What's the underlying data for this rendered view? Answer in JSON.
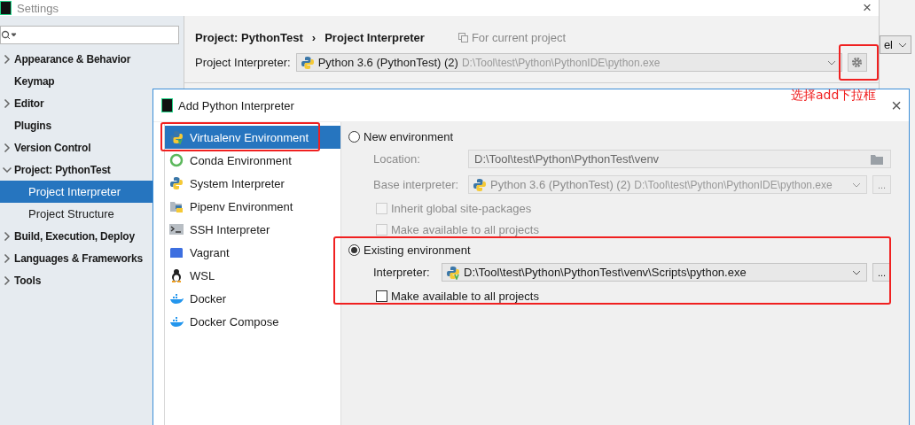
{
  "settings_window": {
    "title": "Settings",
    "close": "×"
  },
  "sidebar": {
    "items": [
      {
        "label": "Appearance & Behavior",
        "expanded": false,
        "selected": false
      },
      {
        "label": "Keymap",
        "selected": false
      },
      {
        "label": "Editor",
        "expanded": false,
        "selected": false
      },
      {
        "label": "Plugins",
        "selected": false
      },
      {
        "label": "Version Control",
        "expanded": false,
        "selected": false
      },
      {
        "label": "Project: PythonTest",
        "expanded": true,
        "selected": false,
        "children": [
          {
            "label": "Project Interpreter",
            "selected": true
          },
          {
            "label": "Project Structure",
            "selected": false
          }
        ]
      },
      {
        "label": "Build, Execution, Deploy",
        "expanded": false,
        "selected": false
      },
      {
        "label": "Languages & Frameworks",
        "expanded": false,
        "selected": false
      },
      {
        "label": "Tools",
        "expanded": false,
        "selected": false
      }
    ]
  },
  "breadcrumb": {
    "items": [
      "Project: PythonTest",
      "Project Interpreter"
    ],
    "separator": "›",
    "scope_note": "For current project"
  },
  "interpreter": {
    "label": "Project Interpreter:",
    "name": "Python 3.6 (PythonTest) (2)",
    "path": "D:\\Tool\\test\\Python\\PythonIDE\\python.exe"
  },
  "background_dropdown": {
    "value": "el"
  },
  "annotation": {
    "text": "选择add下拉框"
  },
  "dialog": {
    "title": "Add Python Interpreter",
    "close": "×",
    "types": [
      {
        "label": "Virtualenv Environment",
        "selected": true
      },
      {
        "label": "Conda Environment",
        "selected": false
      },
      {
        "label": "System Interpreter",
        "selected": false
      },
      {
        "label": "Pipenv Environment",
        "selected": false
      },
      {
        "label": "SSH Interpreter",
        "selected": false
      },
      {
        "label": "Vagrant",
        "selected": false
      },
      {
        "label": "WSL",
        "selected": false
      },
      {
        "label": "Docker",
        "selected": false
      },
      {
        "label": "Docker Compose",
        "selected": false
      }
    ],
    "new_environment": {
      "label": "New environment",
      "selected": false,
      "location": {
        "label": "Location:",
        "value": "D:\\Tool\\test\\Python\\PythonTest\\venv"
      },
      "base_interpreter": {
        "label": "Base interpreter:",
        "name": "Python 3.6 (PythonTest) (2)",
        "path": "D:\\Tool\\test\\Python\\PythonIDE\\python.exe",
        "browse": "..."
      },
      "checkboxes": [
        {
          "label": "Inherit global site-packages",
          "checked": false
        },
        {
          "label": "Make available to all projects",
          "checked": false
        }
      ]
    },
    "existing_environment": {
      "label": "Existing environment",
      "selected": true,
      "interpreter": {
        "label": "Interpreter:",
        "value": "D:\\Tool\\test\\Python\\PythonTest\\venv\\Scripts\\python.exe",
        "browse": "..."
      },
      "checkboxes": [
        {
          "label": "Make available to all projects",
          "checked": false
        }
      ]
    }
  }
}
